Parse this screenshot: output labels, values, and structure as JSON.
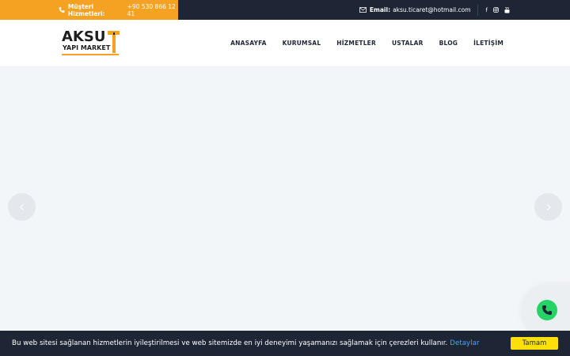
{
  "topbar": {
    "phone_label": "Müşteri Hizmetleri:",
    "phone_value": "+90 530 866 12 41",
    "email_label": "Email:",
    "email_value": "aksu.ticaret@hotmail.com",
    "social_icons": [
      "facebook-icon",
      "instagram-icon",
      "youtube-icon"
    ]
  },
  "logo": {
    "line1": "AKSU",
    "line2": "YAPI MARKET"
  },
  "nav": {
    "items": [
      "ANASAYFA",
      "KURUMSAL",
      "HİZMETLER",
      "USTALAR",
      "BLOG",
      "İLETİŞİM"
    ]
  },
  "cookie": {
    "text": "Bu web sitesi sağlanan hizmetlerin iyileştirilmesi ve web sitemizde en iyi deneyimi yaşamanızı sağlamak için çerezleri kullanır.",
    "link": "Detaylar",
    "button": "Tamam"
  },
  "colors": {
    "accent": "#f5a223",
    "dark": "#1e2636",
    "whatsapp": "#25d366",
    "cookie_button": "#fde00b"
  }
}
